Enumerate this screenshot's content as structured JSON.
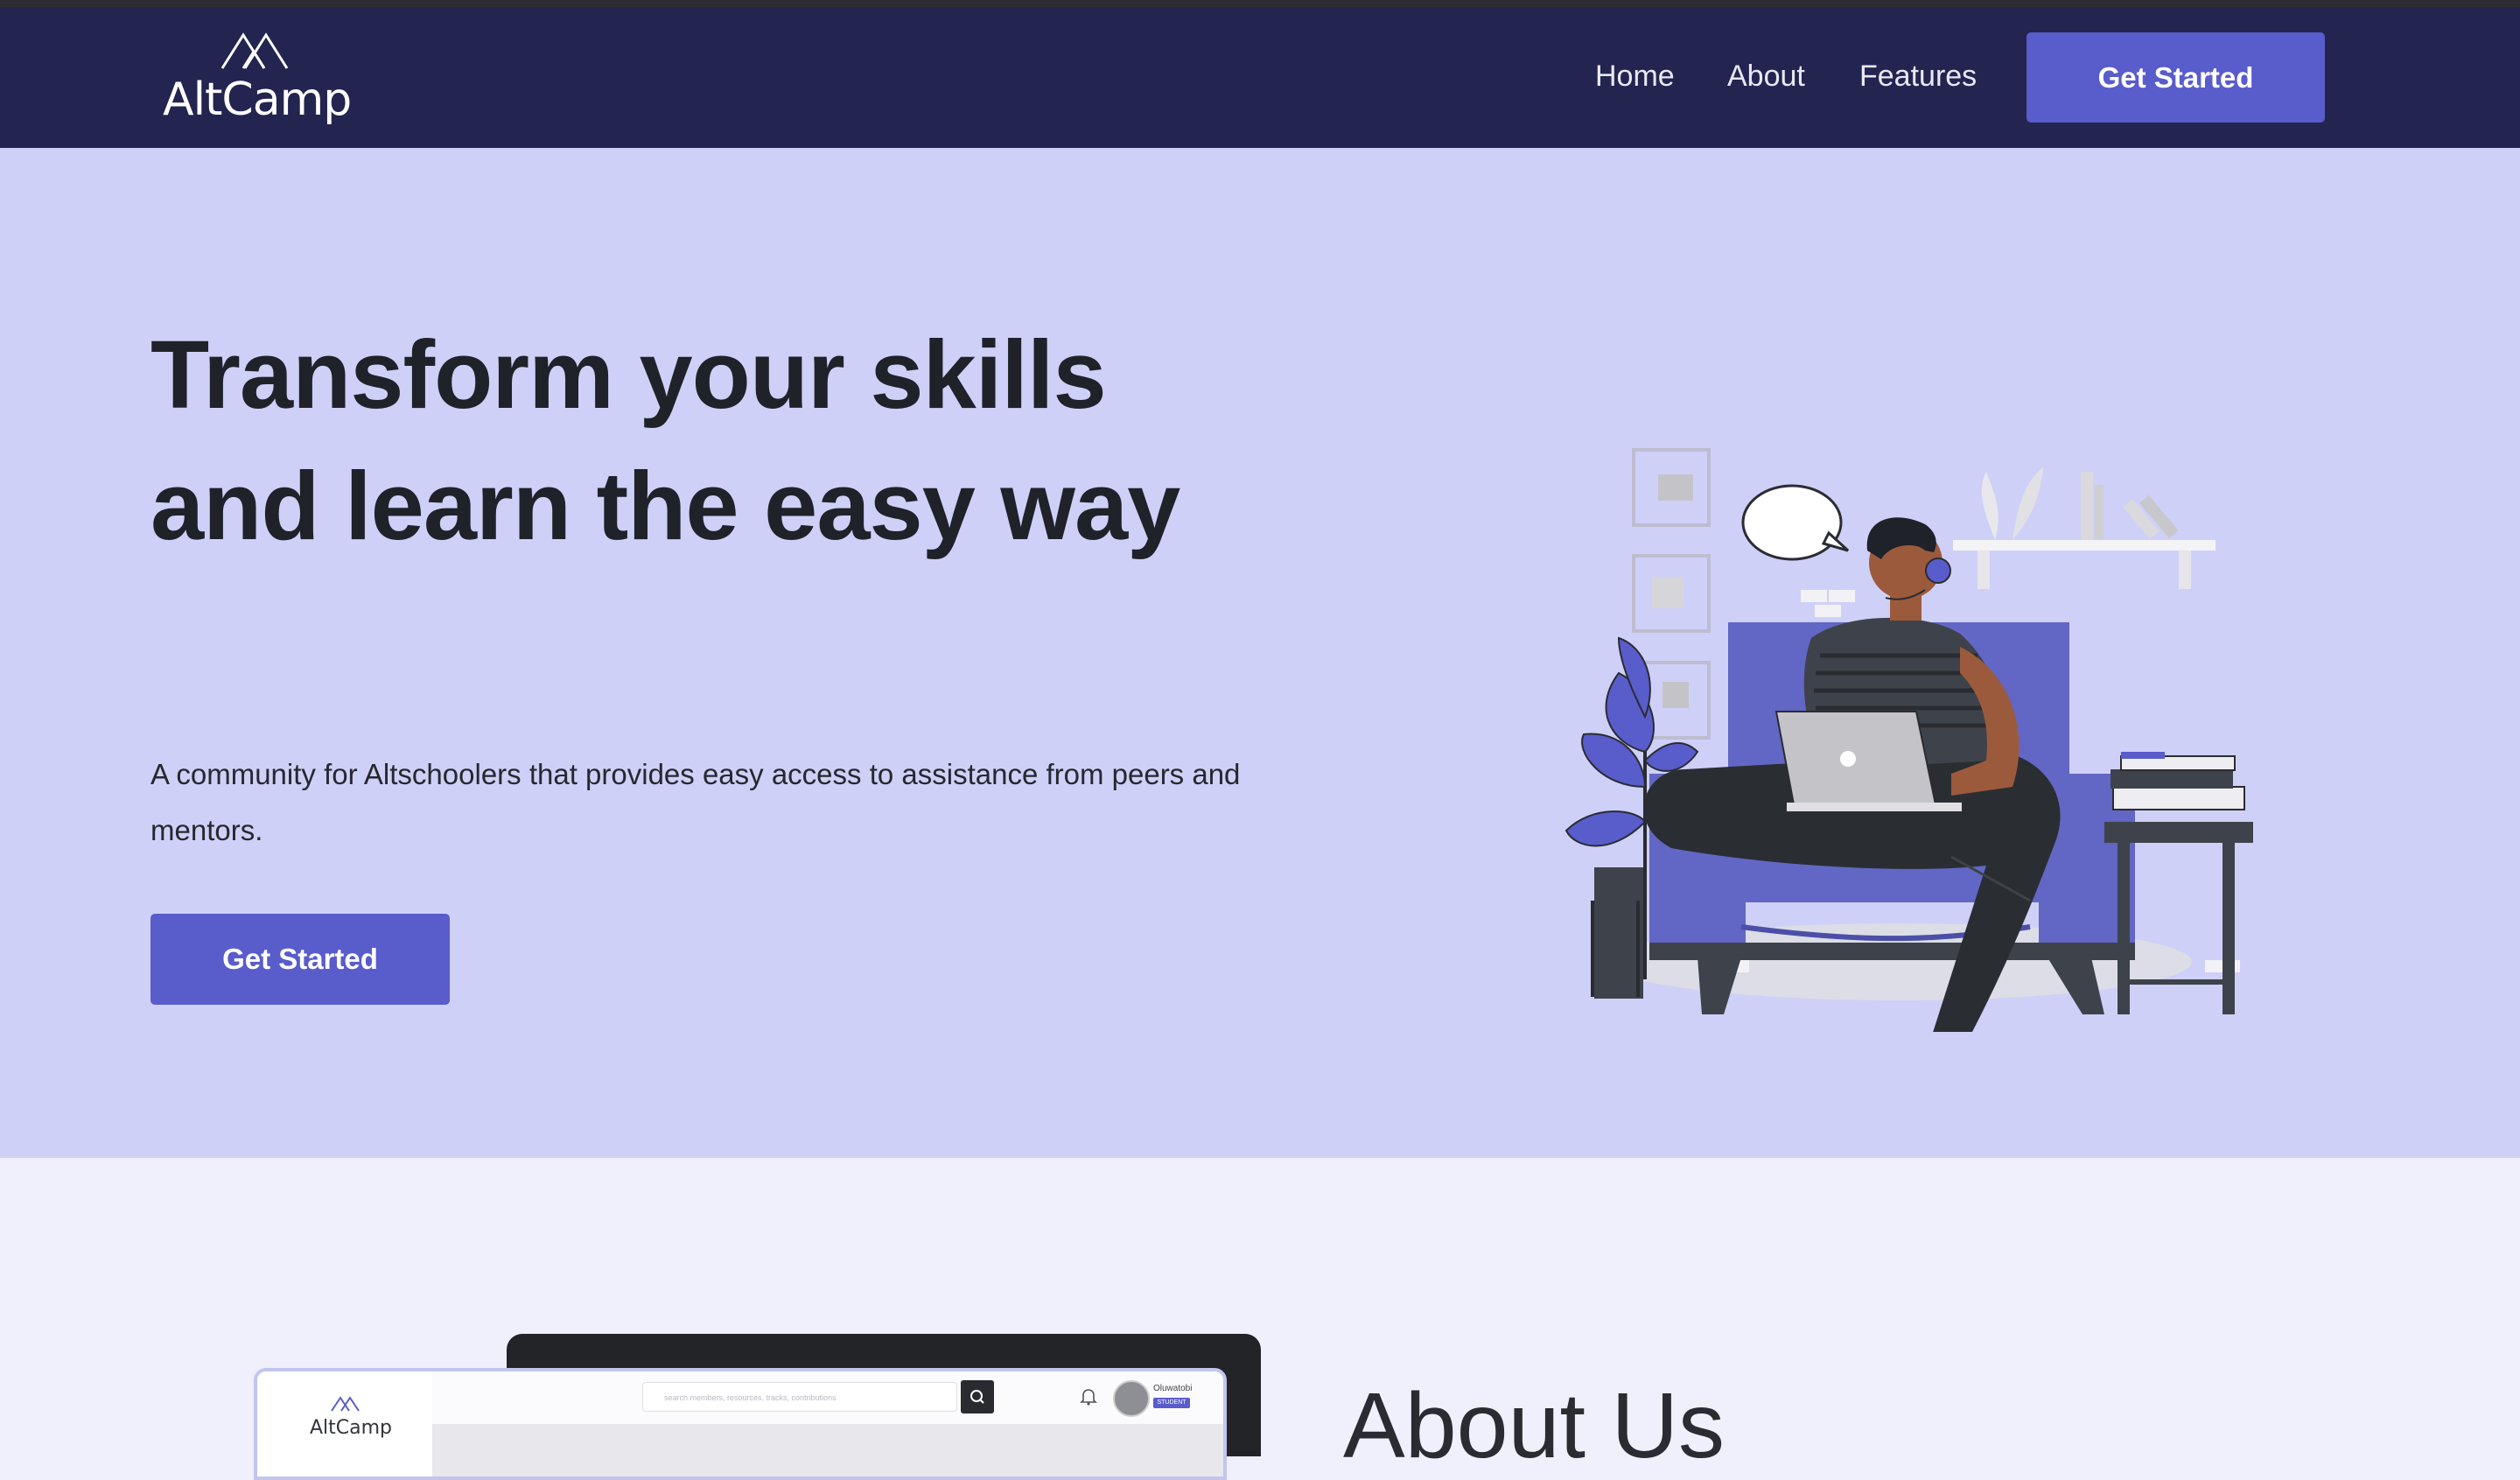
{
  "nav": {
    "logo_text": "AltCamp",
    "links": [
      "Home",
      "About",
      "Features"
    ],
    "cta_label": "Get Started"
  },
  "hero": {
    "title": "Transform your skills and learn the easy way",
    "subtitle": "A community for Altschoolers that provides easy access to assistance from peers and mentors.",
    "cta_label": "Get Started"
  },
  "about": {
    "title": "About Us",
    "preview": {
      "logo_text": "AltCamp",
      "search_placeholder": "search members, resources, tracks, contributions",
      "user_name": "Oluwatobi",
      "user_badge": "STUDENT"
    }
  },
  "colors": {
    "nav_bg": "#232450",
    "hero_bg": "#cfd0f8",
    "accent": "#595ccb",
    "page_bg": "#eff0fc",
    "text_dark": "#1f2229"
  },
  "icons": [
    "altcamp-logo-icon",
    "search-icon",
    "bell-icon",
    "avatar"
  ]
}
